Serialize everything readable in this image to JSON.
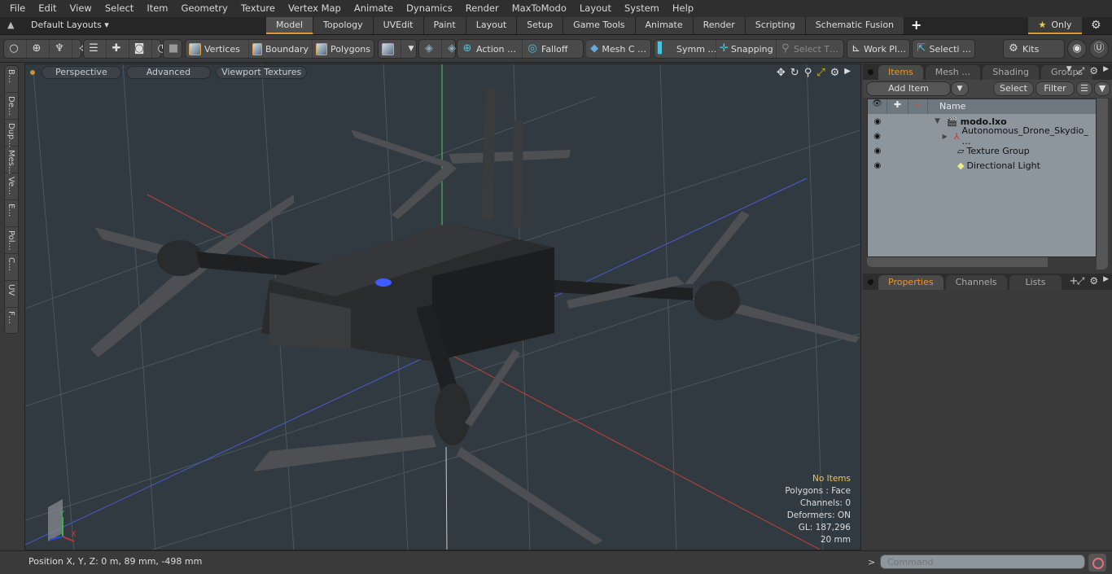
{
  "menu": [
    "File",
    "Edit",
    "View",
    "Select",
    "Item",
    "Geometry",
    "Texture",
    "Vertex Map",
    "Animate",
    "Dynamics",
    "Render",
    "MaxToModo",
    "Layout",
    "System",
    "Help"
  ],
  "layout": {
    "selector_label": "Default Layouts ▾",
    "tabs": [
      {
        "label": "Model",
        "active": true
      },
      {
        "label": "Topology"
      },
      {
        "label": "UVEdit"
      },
      {
        "label": "Paint"
      },
      {
        "label": "Layout"
      },
      {
        "label": "Setup"
      },
      {
        "label": "Game Tools"
      },
      {
        "label": "Animate"
      },
      {
        "label": "Render"
      },
      {
        "label": "Scripting"
      },
      {
        "label": "Schematic Fusion"
      }
    ],
    "add_tab": "+",
    "only_label": "Only",
    "accent": "#e39b2c"
  },
  "toolbar": {
    "vertices": "Vertices",
    "boundary": "Boundary",
    "polygons": "Polygons",
    "action": "Action  …",
    "falloff": "Falloff",
    "mesh": "Mesh C …",
    "symm": "Symm …",
    "snapping": "Snapping",
    "select_t": "Select T…",
    "work_plane": "Work Pl…",
    "selecti": "Selecti …",
    "kits": "Kits"
  },
  "left_tabs": [
    "B…",
    "De…",
    "Dup…",
    "Mes…",
    "Ve…",
    "E…",
    "Pol…",
    "C…",
    "UV",
    "F…"
  ],
  "viewport": {
    "view_mode": "Perspective",
    "shading": "Advanced",
    "textures": "Viewport Textures",
    "info": {
      "selection": "No Items",
      "polygons": "Polygons : Face",
      "channels": "Channels: 0",
      "deformers": "Deformers: ON",
      "gl": "GL: 187,296",
      "scale": "20 mm"
    }
  },
  "items_panel": {
    "tabs": [
      {
        "label": "Items",
        "active": true
      },
      {
        "label": "Mesh …"
      },
      {
        "label": "Shading"
      },
      {
        "label": "Groups"
      }
    ],
    "add_item": "Add Item",
    "select": "Select",
    "filter": "Filter",
    "col_name": "Name",
    "tree": [
      {
        "label": "modo.lxo",
        "bold": true
      },
      {
        "label": "Autonomous_Drone_Skydio_ …"
      },
      {
        "label": "Texture Group"
      },
      {
        "label": "Directional Light"
      }
    ]
  },
  "props_panel": {
    "tabs": [
      {
        "label": "Properties",
        "active": true
      },
      {
        "label": "Channels"
      },
      {
        "label": "Lists"
      }
    ],
    "add": "+"
  },
  "status": {
    "position": "Position X, Y, Z:   0 m, 89 mm, -498 mm",
    "prompt": ">",
    "command_placeholder": "Command"
  }
}
